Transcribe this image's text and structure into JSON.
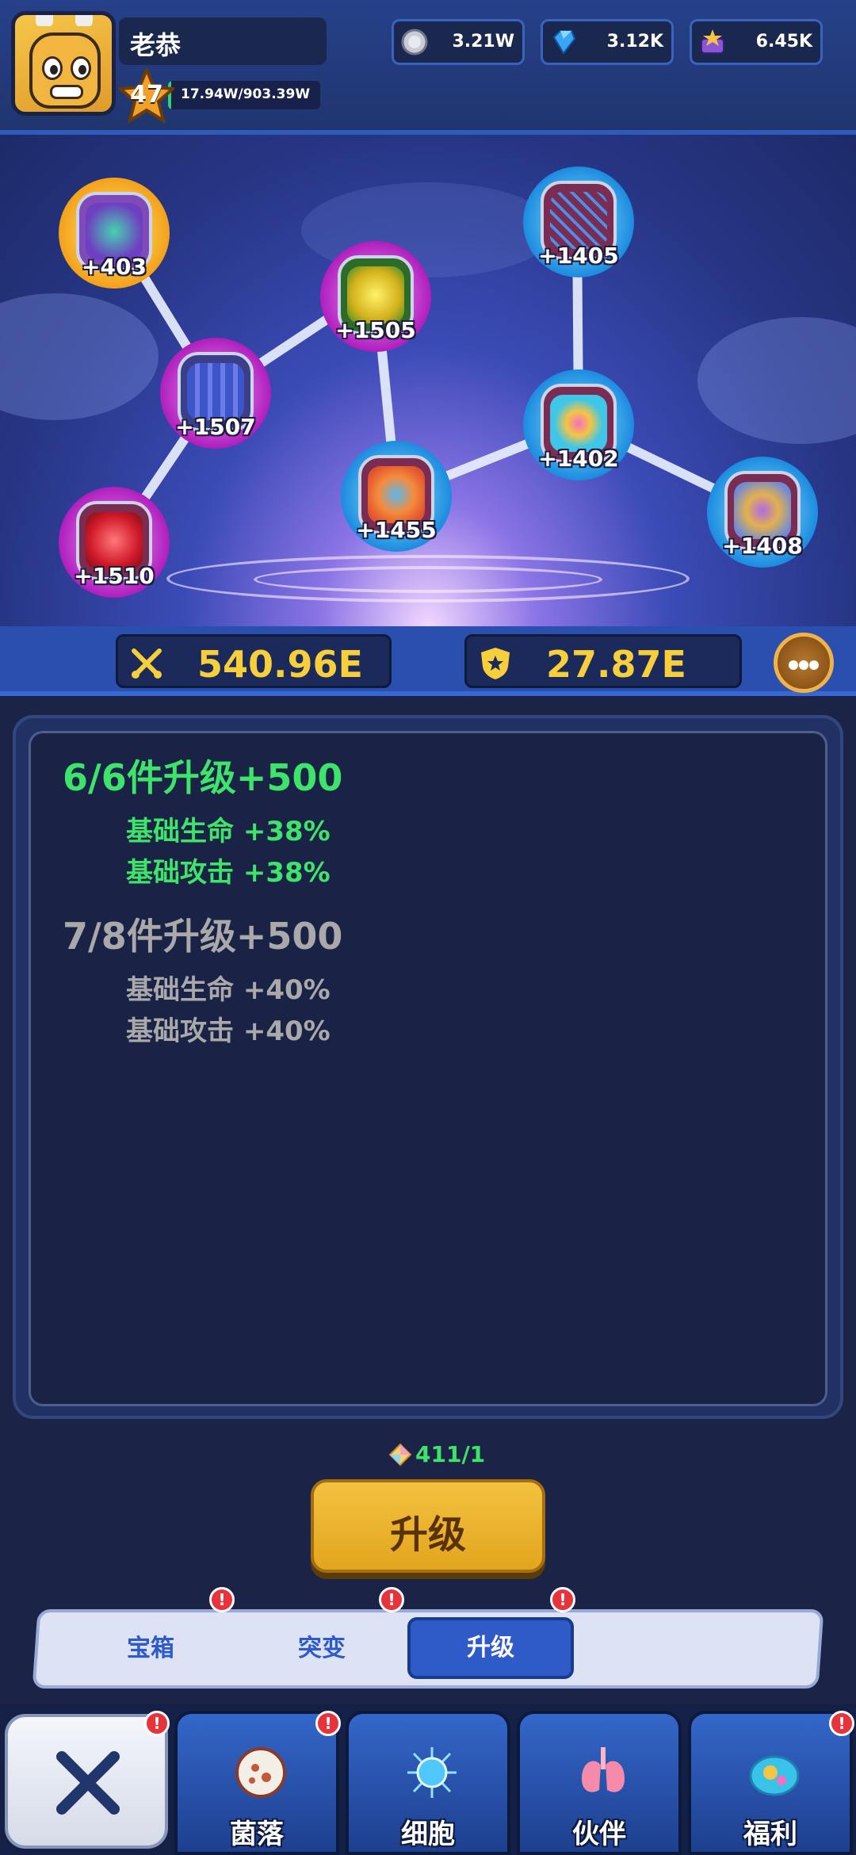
{
  "player": {
    "name": "老恭",
    "level": "47",
    "exp_text": "17.94W/903.39W",
    "exp_progress": 0.0199
  },
  "resources": [
    {
      "icon": "silver-coin-icon",
      "value": "3.21W"
    },
    {
      "icon": "blue-diamond-icon",
      "value": "3.12K"
    },
    {
      "icon": "star-chest-icon",
      "value": "6.45K"
    }
  ],
  "nodes": [
    {
      "name": "node-cell-gold",
      "label": "+403",
      "tier": "gold"
    },
    {
      "name": "node-cell-yellow",
      "label": "+1505",
      "tier": "purple"
    },
    {
      "name": "node-dna",
      "label": "+1405",
      "tier": "blue"
    },
    {
      "name": "node-tissue",
      "label": "+1507",
      "tier": "purple"
    },
    {
      "name": "node-plant-cell",
      "label": "+1402",
      "tier": "blue"
    },
    {
      "name": "node-orange-cell",
      "label": "+1455",
      "tier": "blue"
    },
    {
      "name": "node-mitochondria",
      "label": "+1510",
      "tier": "purple"
    },
    {
      "name": "node-neuron-cell",
      "label": "+1408",
      "tier": "blue"
    }
  ],
  "power": {
    "attack": "540.96E",
    "defense": "27.87E"
  },
  "sets": [
    {
      "title": "6/6件升级+500",
      "lines": [
        "基础生命 +38%",
        "基础攻击 +38%"
      ],
      "active": true
    },
    {
      "title": "7/8件升级+500",
      "lines": [
        "基础生命 +40%",
        "基础攻击 +40%"
      ],
      "active": false
    }
  ],
  "upgrade": {
    "cost": "411/1",
    "button": "升级"
  },
  "tabs": [
    {
      "label": "宝箱",
      "badge": "!"
    },
    {
      "label": "突变",
      "badge": "!"
    },
    {
      "label": "升级",
      "badge": "!",
      "active": true
    }
  ],
  "nav": [
    {
      "label": "菌落",
      "badge": "!"
    },
    {
      "label": "细胞",
      "badge": ""
    },
    {
      "label": "伙伴",
      "badge": ""
    },
    {
      "label": "福利",
      "badge": "!"
    }
  ],
  "close_badge": "!",
  "colors": {
    "active_text": "#3ee46a",
    "inactive_text": "#a9a9a9",
    "power_text": "#f7cf3b",
    "badge": "#e7333b"
  }
}
